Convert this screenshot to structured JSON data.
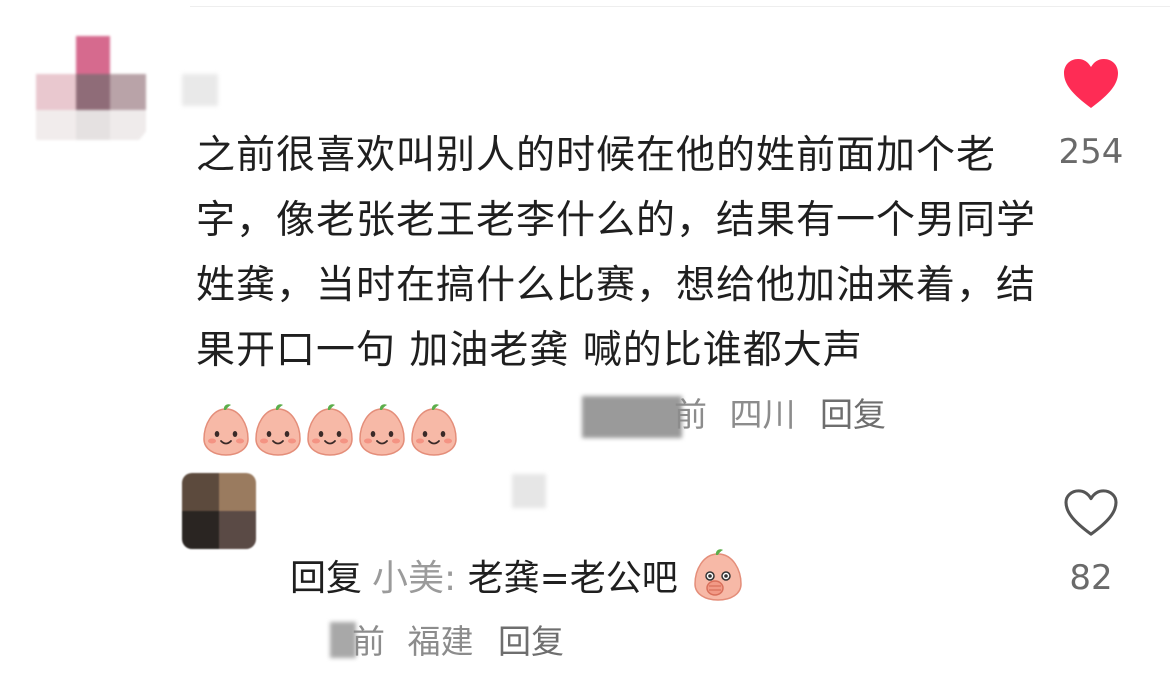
{
  "comment": {
    "text": "之前很喜欢叫别人的时候在他的姓前面加个老字，像老张老王老李什么的，结果有一个男同学姓龚，当时在搞什么比赛，想给他加油来着，结果开口一句 加油老龚 喊的比谁都大声",
    "time_partial": "前",
    "location": "四川",
    "reply_label": "回复",
    "like_count": "254",
    "liked": true,
    "emoji_count": 5,
    "emoji_icon": "peach-smile-icon"
  },
  "reply": {
    "prefix": "回复",
    "mention": "小美:",
    "text": " 老龚=老公吧",
    "emoji_icon": "peach-cover-mouth-icon",
    "time_partial": "前",
    "location": "福建",
    "reply_label": "回复",
    "like_count": "82",
    "liked": false
  },
  "colors": {
    "heart_filled": "#fe2c55",
    "meta_gray": "#8c8c8c",
    "peach": "#f7b9a7"
  }
}
